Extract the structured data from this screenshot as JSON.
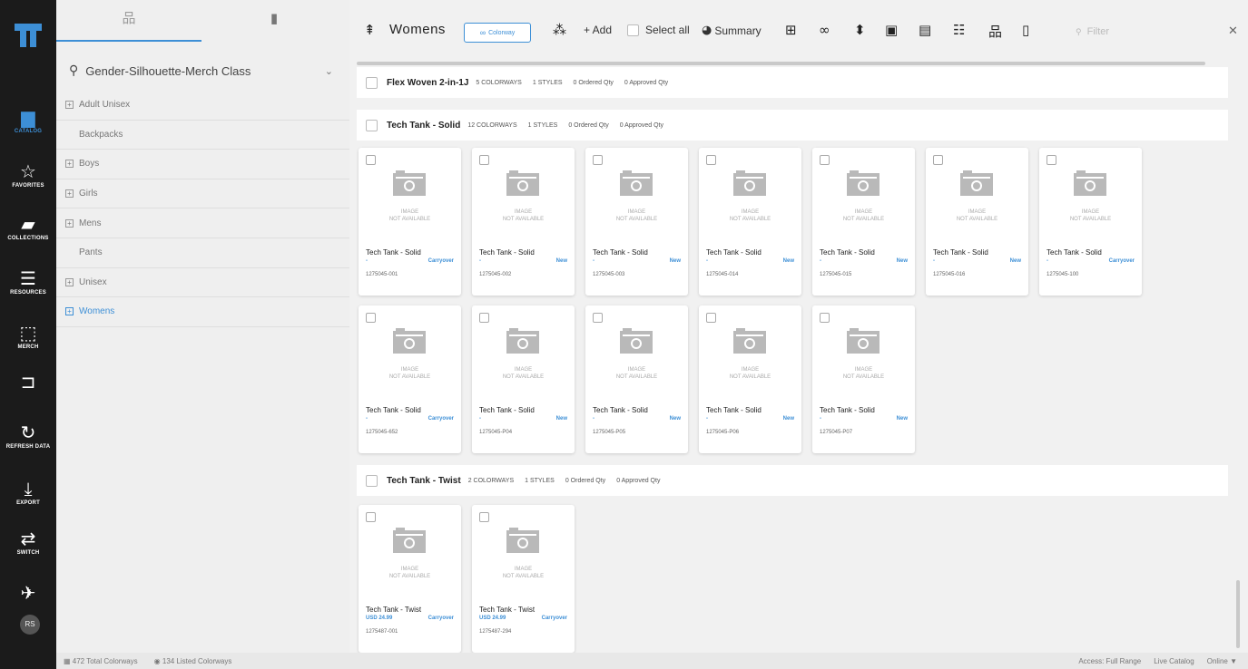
{
  "rail": {
    "items": [
      {
        "label": "CATALOG",
        "glyph": "▆"
      },
      {
        "label": "FAVORITES",
        "glyph": "☆"
      },
      {
        "label": "COLLECTIONS",
        "glyph": "▰"
      },
      {
        "label": "RESOURCES",
        "glyph": "☰"
      },
      {
        "label": "MERCH",
        "glyph": "⬚"
      },
      {
        "label": "",
        "glyph": "⊐"
      },
      {
        "label": "REFRESH DATA",
        "glyph": "↻"
      },
      {
        "label": "EXPORT",
        "glyph": "⤓"
      },
      {
        "label": "SWITCH",
        "glyph": "⇄"
      },
      {
        "label": "",
        "glyph": "✈"
      }
    ],
    "avatar": "RS",
    "accent": "#3d8fd6"
  },
  "sidebar": {
    "group_label": "Gender-Silhouette-Merch Class",
    "items": [
      {
        "label": "Adult Unisex",
        "expandable": true
      },
      {
        "label": "Backpacks",
        "expandable": false
      },
      {
        "label": "Boys",
        "expandable": true
      },
      {
        "label": "Girls",
        "expandable": true
      },
      {
        "label": "Mens",
        "expandable": true
      },
      {
        "label": "Pants",
        "expandable": false
      },
      {
        "label": "Unisex",
        "expandable": true
      },
      {
        "label": "Womens",
        "expandable": true,
        "selected": true
      }
    ]
  },
  "toolbar": {
    "title": "Womens",
    "colorway_label": "Colorway",
    "add_label": "+ Add",
    "select_all_label": "Select all",
    "summary_label": "Summary",
    "filter_placeholder": "Filter"
  },
  "groups": [
    {
      "name": "Flex Woven 2-in-1J",
      "colorways": "5 COLORWAYS",
      "styles": "1 STYLES",
      "ordered": "0 Ordered Qty",
      "approved": "0 Approved Qty"
    },
    {
      "name": "Tech Tank - Solid",
      "colorways": "12 COLORWAYS",
      "styles": "1 STYLES",
      "ordered": "0 Ordered Qty",
      "approved": "0 Approved Qty"
    },
    {
      "name": "Tech Tank - Twist",
      "colorways": "2 COLORWAYS",
      "styles": "1 STYLES",
      "ordered": "0 Ordered Qty",
      "approved": "0 Approved Qty"
    }
  ],
  "image_na": {
    "line1": "IMAGE",
    "line2": "NOT AVAILABLE"
  },
  "cards_solid": [
    {
      "name": "Tech Tank - Solid",
      "price": "-",
      "tag": "Carryover",
      "code": "1275045-001"
    },
    {
      "name": "Tech Tank - Solid",
      "price": "-",
      "tag": "New",
      "code": "1275045-002"
    },
    {
      "name": "Tech Tank - Solid",
      "price": "-",
      "tag": "New",
      "code": "1275045-003"
    },
    {
      "name": "Tech Tank - Solid",
      "price": "-",
      "tag": "New",
      "code": "1275045-014"
    },
    {
      "name": "Tech Tank - Solid",
      "price": "-",
      "tag": "New",
      "code": "1275045-015"
    },
    {
      "name": "Tech Tank - Solid",
      "price": "-",
      "tag": "New",
      "code": "1275045-016"
    },
    {
      "name": "Tech Tank - Solid",
      "price": "-",
      "tag": "Carryover",
      "code": "1275045-100"
    },
    {
      "name": "Tech Tank - Solid",
      "price": "-",
      "tag": "Carryover",
      "code": "1275045-652"
    },
    {
      "name": "Tech Tank - Solid",
      "price": "-",
      "tag": "New",
      "code": "1275045-P04"
    },
    {
      "name": "Tech Tank - Solid",
      "price": "-",
      "tag": "New",
      "code": "1275045-P05"
    },
    {
      "name": "Tech Tank - Solid",
      "price": "-",
      "tag": "New",
      "code": "1275045-P06"
    },
    {
      "name": "Tech Tank - Solid",
      "price": "-",
      "tag": "New",
      "code": "1275045-P07"
    }
  ],
  "cards_twist": [
    {
      "name": "Tech Tank - Twist",
      "price": "USD 24.99",
      "tag": "Carryover",
      "code": "1275487-001"
    },
    {
      "name": "Tech Tank - Twist",
      "price": "USD 24.99",
      "tag": "Carryover",
      "code": "1275487-294"
    }
  ],
  "status": {
    "total": "472 Total Colorways",
    "listed": "134 Listed Colorways",
    "access": "Access: Full Range",
    "catalog": "Live Catalog",
    "online": "Online"
  }
}
